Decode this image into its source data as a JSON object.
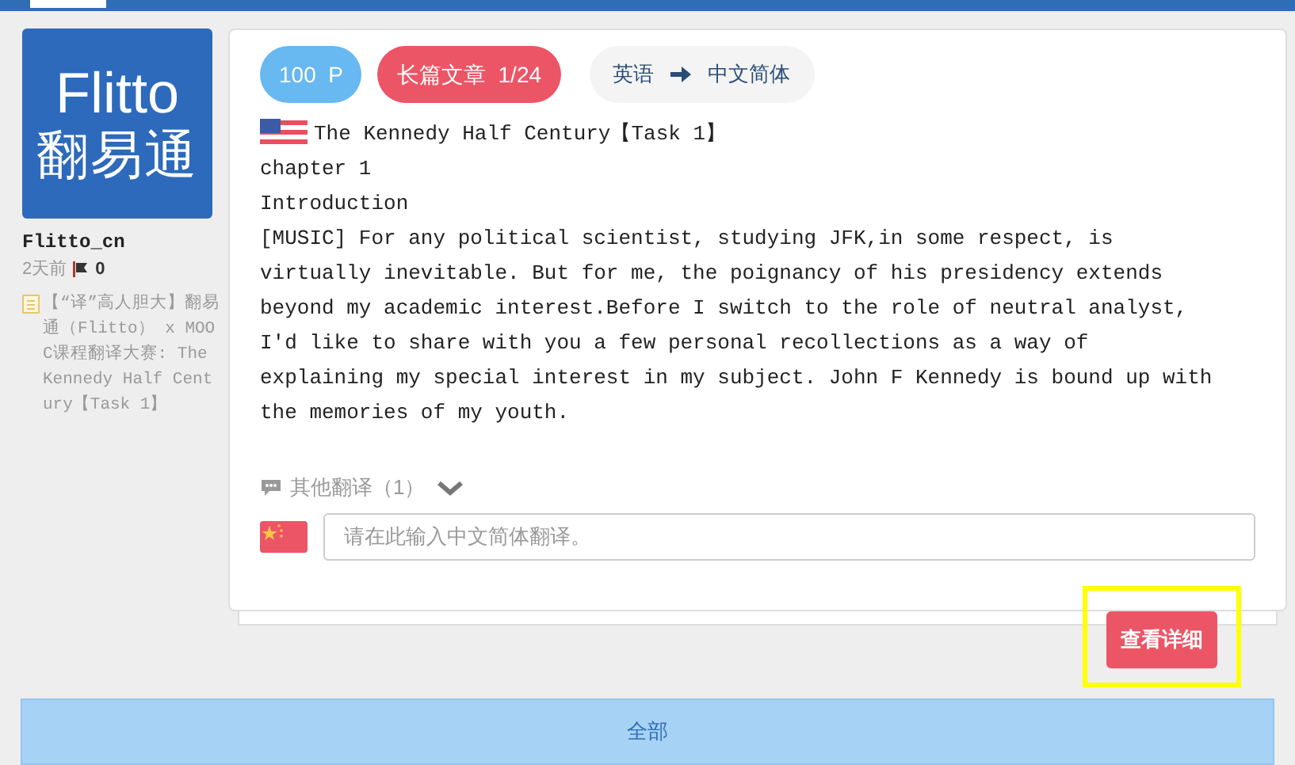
{
  "top_bar": {
    "tabs": [
      {
        "selected": true
      }
    ]
  },
  "user": {
    "logo_word": "Flitto",
    "logo_cjk": "翻易通",
    "name": "Flitto_cn",
    "time": "2天前",
    "flag_count": "0",
    "source_title": "【“译”高人胆大】翻易通（Flitto） x MOOC课程翻译大赛: The Kennedy Half Century【Task 1】"
  },
  "card": {
    "points": "100  P",
    "category": "长篇文章  1/24",
    "source_language": "英语",
    "target_language": "中文简体",
    "title": "The Kennedy Half Century【Task 1】",
    "lines": [
      "chapter 1",
      "Introduction"
    ],
    "body": "[MUSIC] For any political scientist, studying JFK,in some respect, is virtually inevitable. But for me, the poignancy of his presidency extends beyond my academic interest.Before I switch to the role of neutral analyst, I'd like to share with you a few personal recollections as a way of explaining my special interest in my subject. John F Kennedy is bound up with the memories of my youth.",
    "other_translations": "其他翻译（1）",
    "other_expanded": false,
    "input_placeholder": "请在此输入中文简体翻译。"
  },
  "detail_button": {
    "label": "查看详细",
    "highlighted": true
  },
  "all_button": {
    "label": "全部"
  }
}
